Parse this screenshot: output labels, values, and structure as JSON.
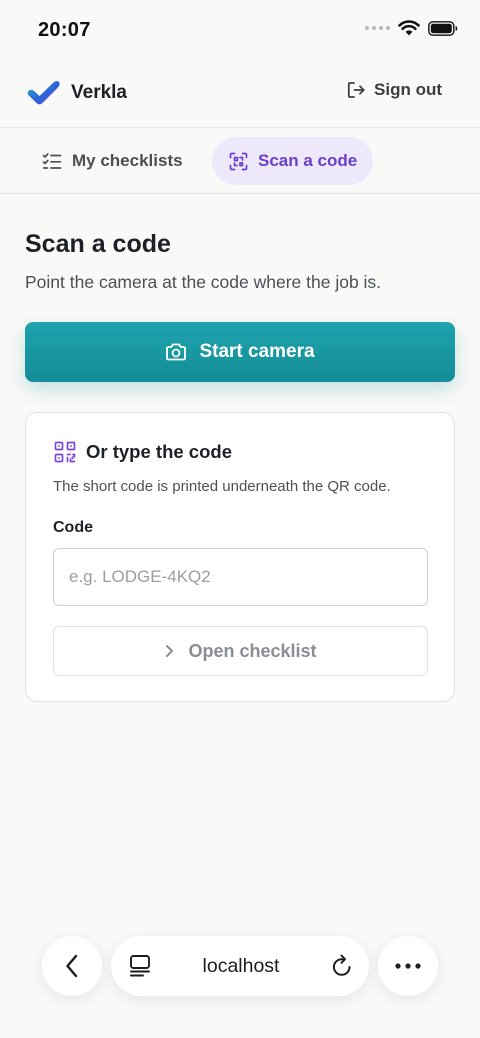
{
  "status_bar": {
    "time": "20:07"
  },
  "header": {
    "brand_name": "Verkla",
    "signout_label": "Sign out"
  },
  "nav": {
    "tabs": [
      {
        "label": "My checklists",
        "icon": "checklist-icon",
        "active": false
      },
      {
        "label": "Scan a code",
        "icon": "scan-icon",
        "active": true
      }
    ]
  },
  "main": {
    "title": "Scan a code",
    "subtitle": "Point the camera at the code where the job is.",
    "start_camera_label": "Start camera",
    "code_card": {
      "heading": "Or type the code",
      "hint": "The short code is printed underneath the QR code.",
      "code_label": "Code",
      "code_placeholder": "e.g. LODGE-4KQ2",
      "code_value": "",
      "open_checklist_label": "Open checklist"
    }
  },
  "browser": {
    "url": "localhost"
  },
  "colors": {
    "accent_teal": "#1a98a2",
    "accent_purple": "#6a3fc9",
    "active_tab_bg": "#ede9fb"
  }
}
